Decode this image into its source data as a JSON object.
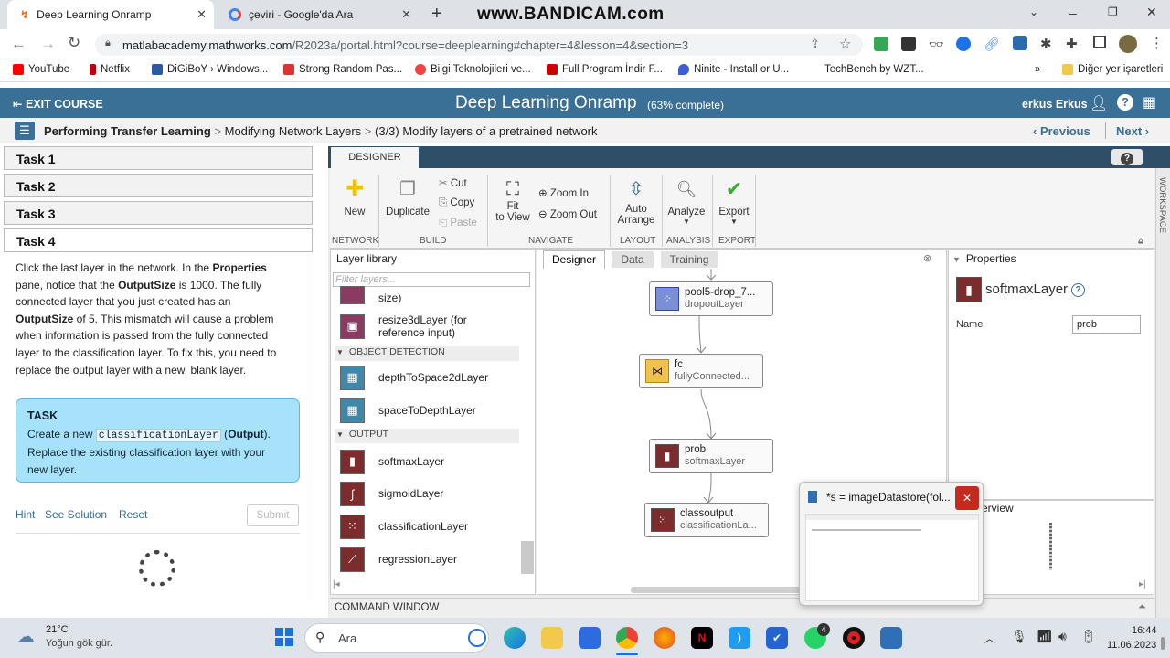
{
  "browser": {
    "tabs": [
      {
        "title": "Deep Learning Onramp",
        "active": true
      },
      {
        "title": "çeviri - Google'da Ara",
        "active": false
      }
    ],
    "new_tab": "+",
    "watermark": "www.BANDICAM.com",
    "url_host": "matlabacademy.mathworks.com",
    "url_path": "/R2023a/portal.html?course=deeplearning#chapter=4&lesson=4&section=3",
    "bookmarks": [
      "YouTube",
      "Netflix",
      "DiGiBoY › Windows...",
      "Strong Random Pas...",
      "Bilgi Teknolojileri ve...",
      "Full Program İndir F...",
      "Ninite - Install or U...",
      "TechBench by WZT..."
    ],
    "bookmarks_more": "»",
    "other_bookmarks": "Diğer yer işaretleri"
  },
  "header": {
    "exit_label": "EXIT COURSE",
    "title": "Deep Learning Onramp",
    "progress": "(63% complete)",
    "progress_value": 63,
    "user": "erkus Erkus"
  },
  "breadcrumb": {
    "part1": "Performing Transfer Learning",
    "sep": ">",
    "part2": "Modifying Network Layers",
    "part3": "(3/3) Modify layers of a pretrained network",
    "previous": "‹ Previous",
    "next": "Next ›"
  },
  "tasks": [
    "Task 1",
    "Task 2",
    "Task 3",
    "Task 4"
  ],
  "instructions": {
    "t1": "Click the last layer in the network. In the ",
    "b1": "Properties",
    "t2": " pane, notice that the ",
    "b2": "OutputSize",
    "t3": " is 1000. The fully connected layer that you just created has an ",
    "b3": "OutputSize",
    "t4": " of 5. This mismatch will cause a problem when information is passed from the fully connected layer to the classification layer. To fix this, you need to replace the output layer with a new, blank layer."
  },
  "taskbox": {
    "heading": "TASK",
    "t1": "Create a new ",
    "code": "classificationLayer",
    "t2": " (",
    "bold": "Output",
    "t3": "). Replace the existing classification layer with your new layer."
  },
  "actions": {
    "hint": "Hint",
    "see_solution": "See Solution",
    "reset": "Reset",
    "submit": "Submit"
  },
  "designer": {
    "tab": "DESIGNER",
    "help": "?",
    "workspace": "WORKSPACE",
    "buttons": {
      "new": "New",
      "duplicate": "Duplicate",
      "cut": "Cut",
      "copy": "Copy",
      "paste": "Paste",
      "fit1": "Fit",
      "fit2": "to View",
      "zoom_in": "Zoom In",
      "zoom_out": "Zoom Out",
      "auto1": "Auto",
      "auto2": "Arrange",
      "analyze": "Analyze",
      "export": "Export"
    },
    "groups": {
      "network": "NETWORK",
      "build": "BUILD",
      "navigate": "NAVIGATE",
      "layout": "LAYOUT",
      "analysis": "ANALYSIS",
      "export": "EXPORT"
    },
    "library": {
      "title": "Layer library",
      "filter_placeholder": "Filter layers...",
      "partial_item": "size)",
      "resize_line1": "resize3dLayer (for",
      "resize_line2": "reference input)",
      "cat_object": "OBJECT DETECTION",
      "depth": "depthToSpace2dLayer",
      "space": "spaceToDepthLayer",
      "cat_output": "OUTPUT",
      "softmax": "softmaxLayer",
      "sigmoid": "sigmoidLayer",
      "classification": "classificationLayer",
      "regression": "regressionLayer"
    },
    "canvas_tabs": [
      "Designer",
      "Data",
      "Training"
    ],
    "nodes": [
      {
        "name": "pool5-drop_7...",
        "type": "dropoutLayer"
      },
      {
        "name": "fc",
        "type": "fullyConnected..."
      },
      {
        "name": "prob",
        "type": "softmaxLayer"
      },
      {
        "name": "classoutput",
        "type": "classificationLa..."
      }
    ],
    "properties": {
      "title": "Properties",
      "layer": "softmaxLayer",
      "help": "?",
      "name_label": "Name",
      "name_value": "prob"
    },
    "overview": "erview",
    "command_window": "COMMAND WINDOW"
  },
  "popup": {
    "title": "*s = imageDatastore(fol...",
    "close": "✕"
  },
  "taskbar": {
    "temp": "21°C",
    "weather": "Yoğun gök gür.",
    "search": "Ara",
    "time": "16:44",
    "date": "11.06.2023",
    "badge": "4"
  },
  "colors": {
    "appbar": "#3a6f96",
    "accent": "#d31f1f",
    "taskbox": "#a6e3fb",
    "designer_blue": "#2f4f69"
  }
}
